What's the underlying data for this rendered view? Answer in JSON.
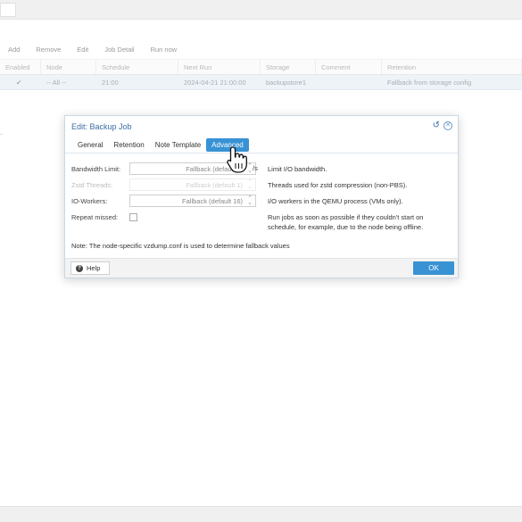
{
  "toolbar": {
    "buttons": [
      "Add",
      "Remove",
      "Edit",
      "Job Detail",
      "Run now"
    ]
  },
  "grid": {
    "columns": [
      "Enabled",
      "Node",
      "Schedule",
      "Next Run",
      "Storage",
      "Comment",
      "Retention"
    ],
    "rows": [
      {
        "enabled": "✔",
        "node": "-- All --",
        "schedule": "21:00",
        "next_run": "2024-04-21 21:00:00",
        "storage": "backupstore1",
        "comment": "",
        "retention": "Fallback from storage config"
      }
    ]
  },
  "dialog": {
    "title": "Edit: Backup Job",
    "tabs": [
      "General",
      "Retention",
      "Note Template",
      "Advanced"
    ],
    "active_tab": "Advanced",
    "fields": {
      "bandwidth": {
        "label": "Bandwidth Limit:",
        "value": "Fallback (default 0)",
        "unit": "/s",
        "desc": "Limit I/O bandwidth."
      },
      "zstd": {
        "label": "Zstd Threads:",
        "value": "Fallback (default 1)",
        "desc": "Threads used for zstd compression (non-PBS)."
      },
      "io_workers": {
        "label": "IO-Workers:",
        "value": "Fallback (default 16)",
        "desc": "I/O workers in the QEMU process (VMs only)."
      },
      "repeat": {
        "label": "Repeat missed:",
        "desc": "Run jobs as soon as possible if they couldn't start on schedule, for example, due to the node being offline."
      }
    },
    "note_prefix": "Note:",
    "note_text": "The node-specific vzdump.conf is used to determine fallback values",
    "help_label": "Help",
    "ok_label": "OK"
  },
  "colors": {
    "accent": "#3892d4",
    "title": "#3b6ea5"
  }
}
